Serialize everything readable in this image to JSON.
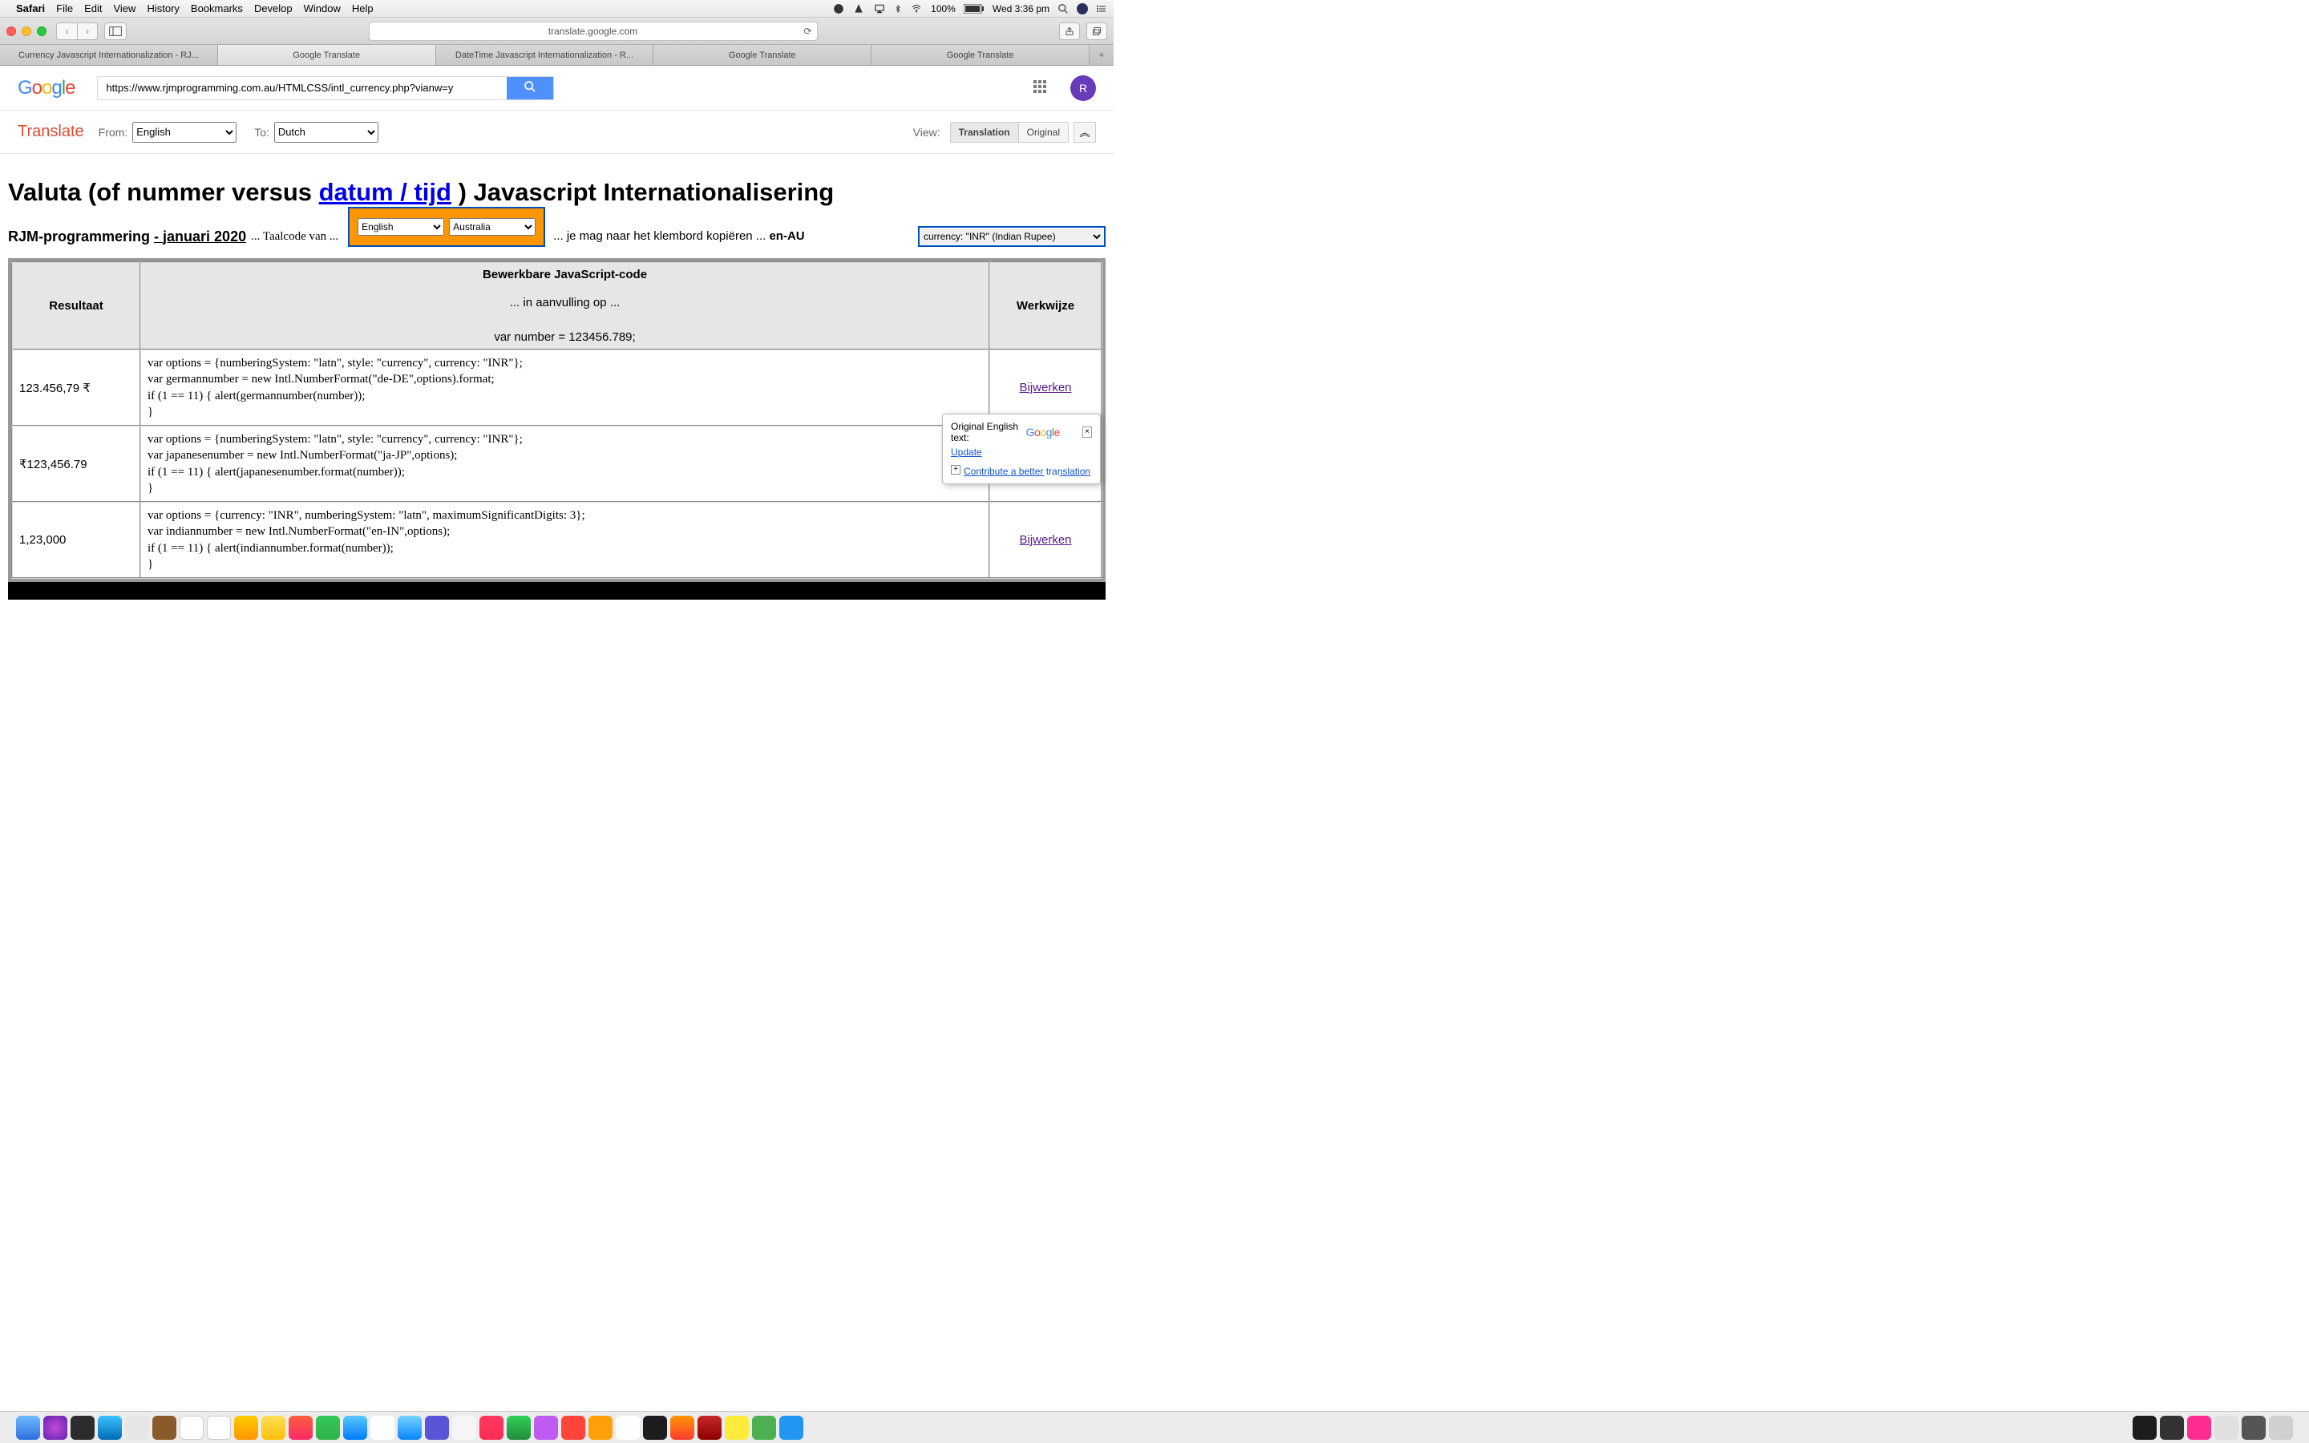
{
  "menubar": {
    "app": "Safari",
    "items": [
      "File",
      "Edit",
      "View",
      "History",
      "Bookmarks",
      "Develop",
      "Window",
      "Help"
    ],
    "battery": "100%",
    "clock": "Wed 3:36 pm"
  },
  "browser": {
    "address": "translate.google.com",
    "tabs": [
      "Currency Javascript Internationalization - RJ...",
      "Google Translate",
      "DateTime Javascript Internationalization - R...",
      "Google Translate",
      "Google Translate"
    ],
    "active_tab": 1
  },
  "gt_header": {
    "search_value": "https://www.rjmprogramming.com.au/HTMLCSS/intl_currency.php?vianw=y",
    "avatar_initial": "R"
  },
  "gt_toolbar": {
    "brand": "Translate",
    "from_label": "From:",
    "from_value": "English",
    "to_label": "To:",
    "to_value": "Dutch",
    "view_label": "View:",
    "view_translation": "Translation",
    "view_original": "Original"
  },
  "page": {
    "title_pre": "Valuta (of nummer versus ",
    "title_link": "datum / tijd",
    "title_post": " ) Javascript Internationalisering",
    "rjm": "RJM-programmering ",
    "rjm_dash": "- ",
    "rjm_date": "januari 2020",
    "taal": " ... Taalcode van ...",
    "orange_lang": "English",
    "orange_country": "Australia",
    "copytext": "... je mag naar het klembord kopiëren ... ",
    "copytext_bold": "en-AU",
    "currency_select": "currency: \"INR\" (Indian Rupee)"
  },
  "table": {
    "header_result": "Resultaat",
    "header_code": "Bewerkbare JavaScript-code",
    "header_sub": "... in aanvulling op ...",
    "header_varline": "var number = 123456.789;",
    "header_action": "Werkwijze",
    "rows": [
      {
        "result": "123.456,79 ₹",
        "code": "var options = {numberingSystem: \"latn\", style: \"currency\", currency: \"INR\"};\nvar germannumber = new Intl.NumberFormat(\"de-DE\",options).format;\nif (1 == 11) { alert(germannumber(number));\n}",
        "action": "Bijwerken"
      },
      {
        "result": "₹123,456.79",
        "code": "var options = {numberingSystem: \"latn\", style: \"currency\", currency: \"INR\"};\nvar japanesenumber = new Intl.NumberFormat(\"ja-JP\",options);\nif (1 == 11) { alert(japanesenumber.format(number));\n}",
        "action": ""
      },
      {
        "result": "1,23,000",
        "code": "var options = {currency: \"INR\", numberingSystem: \"latn\", maximumSignificantDigits: 3};\nvar indiannumber = new Intl.NumberFormat(\"en-IN\",options);\nif (1 == 11) { alert(indiannumber.format(number));\n}",
        "action": "Bijwerken"
      }
    ]
  },
  "tooltip": {
    "label": "Original English text:",
    "update": "Update",
    "contribute": "Contribute a better translation"
  }
}
